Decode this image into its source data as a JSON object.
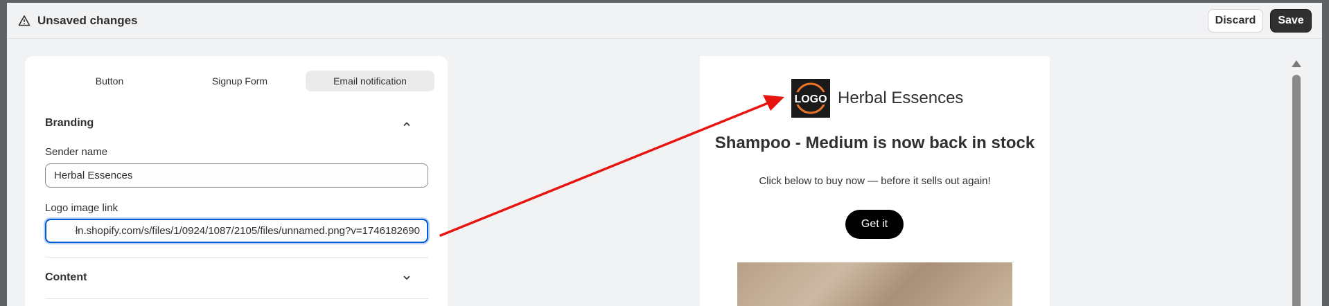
{
  "topbar": {
    "title": "Unsaved changes",
    "discard_label": "Discard",
    "save_label": "Save"
  },
  "tabs": [
    {
      "label": "Button",
      "active": false
    },
    {
      "label": "Signup Form",
      "active": false
    },
    {
      "label": "Email notification",
      "active": true
    }
  ],
  "branding": {
    "title": "Branding",
    "sender_label": "Sender name",
    "sender_value": "Herbal Essences",
    "logo_label": "Logo image link",
    "logo_value": "łn.shopify.com/s/files/1/0924/1087/2105/files/unnamed.png?v=1746182690"
  },
  "content_section": {
    "title": "Content"
  },
  "preview": {
    "logo_text": "LOGO",
    "brand_name": "Herbal Essences",
    "headline": "Shampoo - Medium is now back in stock",
    "subtext": "Click below to buy now — before it sells out again!",
    "cta_label": "Get it"
  },
  "colors": {
    "accent_focus": "#005bd3",
    "save_bg": "#303030",
    "annotation_arrow": "#e8140f",
    "logo_ring": "#e8742a"
  },
  "icons": {
    "warning": "warning-triangle-icon",
    "expand": "chevron-up-icon",
    "collapse": "chevron-down-icon"
  }
}
